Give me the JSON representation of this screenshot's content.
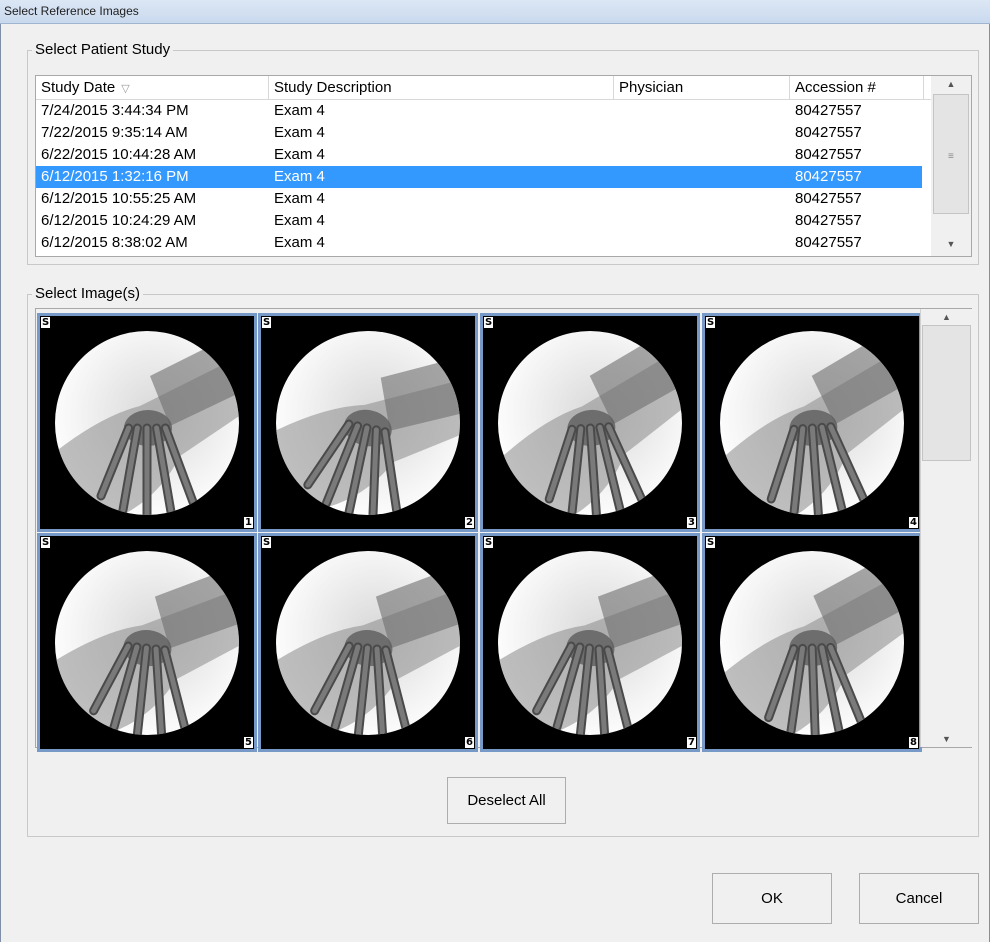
{
  "window": {
    "title": "Select Reference Images"
  },
  "patient_study": {
    "group_label": "Select Patient Study",
    "columns": [
      "Study Date",
      "Study Description",
      "Physician",
      "Accession #"
    ],
    "sort_indicator": "▽",
    "rows": [
      {
        "date": "7/24/2015 3:44:34 PM",
        "description": "Exam 4",
        "physician": "",
        "accession": "80427557"
      },
      {
        "date": "7/22/2015 9:35:14 AM",
        "description": "Exam 4",
        "physician": "",
        "accession": "80427557"
      },
      {
        "date": "6/22/2015 10:44:28 AM",
        "description": "Exam 4",
        "physician": "",
        "accession": "80427557"
      },
      {
        "date": "6/12/2015 1:32:16 PM",
        "description": "Exam 4",
        "physician": "",
        "accession": "80427557",
        "selected": true
      },
      {
        "date": "6/12/2015 10:55:25 AM",
        "description": "Exam 4",
        "physician": "",
        "accession": "80427557"
      },
      {
        "date": "6/12/2015 10:24:29 AM",
        "description": "Exam 4",
        "physician": "",
        "accession": "80427557"
      },
      {
        "date": "6/12/2015 8:38:02 AM",
        "description": "Exam 4",
        "physician": "",
        "accession": "80427557"
      }
    ],
    "scroll_up": "▲",
    "scroll_down": "▼",
    "scroll_grip": "≡"
  },
  "images": {
    "group_label": "Select Image(s)",
    "items": [
      {
        "badge": "S",
        "number": "1"
      },
      {
        "badge": "S",
        "number": "2"
      },
      {
        "badge": "S",
        "number": "3"
      },
      {
        "badge": "S",
        "number": "4"
      },
      {
        "badge": "S",
        "number": "5"
      },
      {
        "badge": "S",
        "number": "6"
      },
      {
        "badge": "S",
        "number": "7"
      },
      {
        "badge": "S",
        "number": "8"
      }
    ],
    "scroll_up": "▲",
    "scroll_down": "▼",
    "deselect_all_label": "Deselect All"
  },
  "footer": {
    "ok_label": "OK",
    "cancel_label": "Cancel"
  },
  "colors": {
    "selection": "#3399ff",
    "thumb_border": "#7799c8"
  },
  "icons": {
    "xray_thumbnail": "hand-xray-image"
  }
}
